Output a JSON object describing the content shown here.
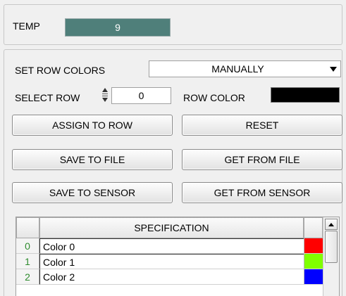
{
  "temp": {
    "label": "TEMP",
    "value": "9"
  },
  "set_row_colors": {
    "label": "SET ROW COLORS",
    "selected": "MANUALLY"
  },
  "select_row": {
    "label": "SELECT ROW",
    "value": "0"
  },
  "row_color": {
    "label": "ROW COLOR",
    "color": "#000000"
  },
  "buttons": {
    "assign_to_row": "ASSIGN TO ROW",
    "reset": "RESET",
    "save_to_file": "SAVE TO FILE",
    "get_from_file": "GET FROM FILE",
    "save_to_sensor": "SAVE TO SENSOR",
    "get_from_sensor": "GET FROM SENSOR"
  },
  "table": {
    "header": "SPECIFICATION",
    "rows": [
      {
        "num": "0",
        "name": "Color 0",
        "color": "#ff0000"
      },
      {
        "num": "1",
        "name": "Color 1",
        "color": "#80ff00"
      },
      {
        "num": "2",
        "name": "Color 2",
        "color": "#0000ff"
      }
    ]
  },
  "colors": {
    "temp_bg": "#4f7f7a",
    "row_number_text": "#2e8b2e"
  }
}
